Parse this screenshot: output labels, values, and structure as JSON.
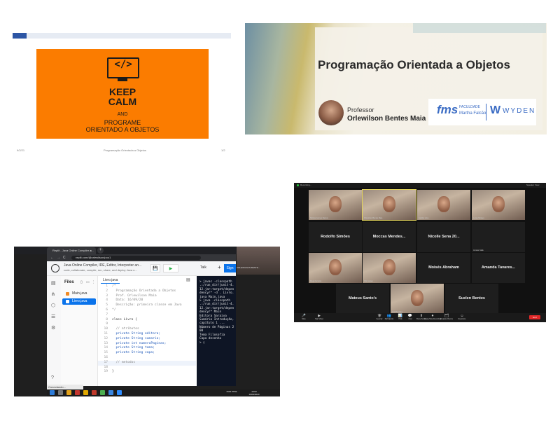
{
  "slide1": {
    "code_glyph": "</>",
    "keep": "KEEP",
    "calm": "CALM",
    "and": "AND",
    "programe": "PROGRAME",
    "orientado": "ORIENTADO A OBJETOS",
    "footer_date": "9/2/21",
    "footer_title": "Programação Orientada a Objetos",
    "footer_page": "1/2"
  },
  "slide2": {
    "title": "Programação Orientada a Objetos",
    "professor_label": "Professor",
    "professor_name": "Orlewilson Bentes Maia",
    "logo_fms": "fms",
    "logo_faculdade": "FACULDADE",
    "logo_martha": "Martha Falcão",
    "logo_w": "W",
    "logo_wyden": "WYDEN"
  },
  "zoom": {
    "recording": "Recording...",
    "view": "Speaker View",
    "tiles": [
      {
        "name": "",
        "small": "Heloisa Gomes Ramos",
        "video": true
      },
      {
        "name": "",
        "small": "Orlewilson Bentes Maia",
        "video": true,
        "active": true
      },
      {
        "name": "",
        "small": "Gabriel Lima",
        "video": true
      },
      {
        "name": "",
        "small": "Lucas Moraes",
        "video": true
      },
      {
        "name": "Rodolfo Simões",
        "small": "",
        "video": false
      },
      {
        "name": "Moccas  Mendes...",
        "small": "",
        "video": false
      },
      {
        "name": "Nicolle Sena 20...",
        "small": "",
        "video": false
      },
      {
        "name": "",
        "small": "Jonatas Valle",
        "video": false
      },
      {
        "name": "",
        "small": "Diego Ferreira",
        "video": true
      },
      {
        "name": "",
        "small": "Vitor Lopes",
        "video": true
      },
      {
        "name": "Moisés Abraham",
        "small": "",
        "video": false
      },
      {
        "name": "Amanda  Tavares...",
        "small": "",
        "video": false
      },
      {
        "name": "Mateus Santo's",
        "small": "",
        "video": false
      },
      {
        "name": "",
        "small": "Luiz Henrique",
        "video": true
      },
      {
        "name": "Suelen Bentes",
        "small": "",
        "video": false
      }
    ],
    "toolbar": [
      {
        "icon": "🎤",
        "label": "Mute"
      },
      {
        "icon": "▶",
        "label": "Start Video"
      },
      {
        "icon": "🛡",
        "label": "Security"
      },
      {
        "icon": "👥",
        "label": "Participants"
      },
      {
        "icon": "📊",
        "label": "Polls"
      },
      {
        "icon": "💬",
        "label": "Chat"
      },
      {
        "icon": "⬆",
        "label": "Share Screen"
      },
      {
        "icon": "⏺",
        "label": "Pause/Stop Recording"
      },
      {
        "icon": "🗂",
        "label": "Breakout Rooms"
      },
      {
        "icon": "☺",
        "label": "Reactions"
      }
    ],
    "end": "End"
  },
  "browser": {
    "tab_title": "Replit - Java Online Compiler a...",
    "tab_close": "×",
    "new_tab": "+",
    "back": "←",
    "forward": "→",
    "reload": "C",
    "url": "replit.com/@orlewilson/poo1",
    "repl_title": "Java Online Compiler, IDE, Editor, Interpreter an...",
    "repl_desc": "code, collaborate, compile, run, share, and deploy Java o...",
    "save_icon": "💾",
    "run_icon": "▶",
    "talk": "Talk",
    "plus": "+",
    "sign": "Sign",
    "files_title": "Files",
    "files": [
      {
        "name": "Main.java",
        "selected": false
      },
      {
        "name": "Livro.java",
        "selected": true
      }
    ],
    "editor_tab": "Livro.java",
    "code_lines": [
      {
        "n": "1",
        "t": "/*",
        "k": "cm"
      },
      {
        "n": "2",
        "t": "  Programação Orientada a Objetos",
        "k": "cm"
      },
      {
        "n": "3",
        "t": "  Prof. Orlewilson Maia",
        "k": "cm"
      },
      {
        "n": "4",
        "t": "  Data: 16/09/20",
        "k": "cm"
      },
      {
        "n": "5",
        "t": "  Descrição: primeira classe em Java",
        "k": "cm"
      },
      {
        "n": "6",
        "t": "*/",
        "k": "cm"
      },
      {
        "n": "7",
        "t": "",
        "k": ""
      },
      {
        "n": "8",
        "t": "class Livro {",
        "k": ""
      },
      {
        "n": "9",
        "t": "",
        "k": ""
      },
      {
        "n": "10",
        "t": "  // atributos",
        "k": "cm"
      },
      {
        "n": "11",
        "t": "  private String editora;",
        "k": "kw"
      },
      {
        "n": "12",
        "t": "  private String sumario;",
        "k": "kw"
      },
      {
        "n": "13",
        "t": "  private int numeroPaginas;",
        "k": "kw"
      },
      {
        "n": "14",
        "t": "  private String tema;",
        "k": "kw"
      },
      {
        "n": "15",
        "t": "  private String capa;",
        "k": "kw"
      },
      {
        "n": "16",
        "t": "",
        "k": ""
      },
      {
        "n": "17",
        "t": "  // metodos",
        "k": "cm"
      },
      {
        "n": "18",
        "t": "",
        "k": ""
      },
      {
        "n": "19",
        "t": "}",
        "k": ""
      }
    ],
    "console": "> javac -classpath .:/run_dir/junit-4.12.jar:target/dependency/* -d . Livro.java Main.java\n> java -classpath .:/run_dir/junit-4.12.jar:target/dependency/* Main\nEditora Saraiva\nSumário Introdução, capítulo 1 ...\nNúmero de Páginas 200\nTema Filosofia\nCapa desenho\n> ▯",
    "side_label": "ORLEWILSON BENTE...",
    "status": "Conectando...",
    "clock_time": "19:02",
    "clock_date": "16/09/2020",
    "tray_lang": "POR PTB2"
  }
}
